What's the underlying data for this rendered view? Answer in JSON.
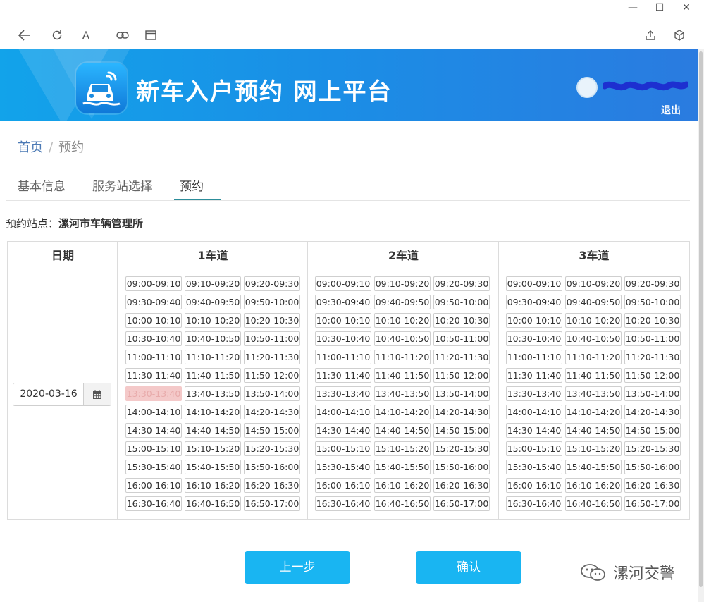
{
  "window": {
    "minimize_glyph": "—",
    "maximize_glyph": "☐",
    "close_glyph": "✕"
  },
  "toolbar": {
    "font_glyph": "A"
  },
  "header": {
    "title": "新车入户预约 网上平台",
    "logout": "退出"
  },
  "breadcrumb": {
    "home": "首页",
    "separator": "/",
    "current": "预约"
  },
  "tabs": [
    {
      "label": "基本信息"
    },
    {
      "label": "服务站选择"
    },
    {
      "label": "预约"
    }
  ],
  "station": {
    "label": "预约站点：",
    "value": "漯河市车辆管理所"
  },
  "table": {
    "headers": [
      "日期",
      "1车道",
      "2车道",
      "3车道"
    ],
    "date": "2020-03-16",
    "slots": [
      [
        "09:00-09:10",
        "09:10-09:20",
        "09:20-09:30"
      ],
      [
        "09:30-09:40",
        "09:40-09:50",
        "09:50-10:00"
      ],
      [
        "10:00-10:10",
        "10:10-10:20",
        "10:20-10:30"
      ],
      [
        "10:30-10:40",
        "10:40-10:50",
        "10:50-11:00"
      ],
      [
        "11:00-11:10",
        "11:10-11:20",
        "11:20-11:30"
      ],
      [
        "11:30-11:40",
        "11:40-11:50",
        "11:50-12:00"
      ],
      [
        "13:30-13:40",
        "13:40-13:50",
        "13:50-14:00"
      ],
      [
        "14:00-14:10",
        "14:10-14:20",
        "14:20-14:30"
      ],
      [
        "14:30-14:40",
        "14:40-14:50",
        "14:50-15:00"
      ],
      [
        "15:00-15:10",
        "15:10-15:20",
        "15:20-15:30"
      ],
      [
        "15:30-15:40",
        "15:40-15:50",
        "15:50-16:00"
      ],
      [
        "16:00-16:10",
        "16:10-16:20",
        "16:20-16:30"
      ],
      [
        "16:30-16:40",
        "16:40-16:50",
        "16:50-17:00"
      ]
    ],
    "disabled_slot": {
      "lane": 1,
      "time": "13:30-13:40"
    }
  },
  "buttons": {
    "prev": "上一步",
    "confirm": "确认"
  },
  "watermark": "漯河交警",
  "colors": {
    "banner": "#1a8fe6",
    "button": "#19b5f2",
    "link": "#4c7ab5",
    "tab_underline": "#2c8d9a",
    "disabled_slot": "#f4c9c9"
  }
}
